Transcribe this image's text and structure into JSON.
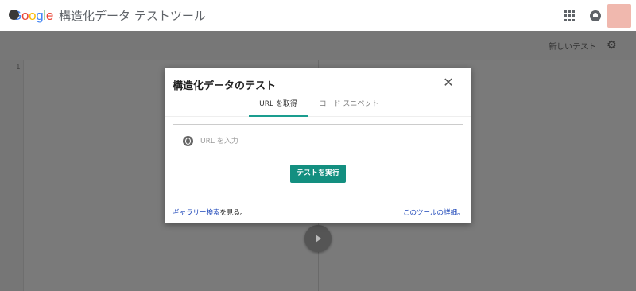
{
  "app": {
    "logo_letters": [
      {
        "ch": "G",
        "color": "#4285F4"
      },
      {
        "ch": "o",
        "color": "#EA4335"
      },
      {
        "ch": "o",
        "color": "#FBBC05"
      },
      {
        "ch": "g",
        "color": "#4285F4"
      },
      {
        "ch": "l",
        "color": "#34A853"
      },
      {
        "ch": "e",
        "color": "#EA4335"
      }
    ],
    "title": "構造化データ テストツール",
    "apps_icon": "apps-grid-icon",
    "notifications_icon": "bell-icon"
  },
  "toolbar": {
    "new_test_label": "新しいテスト",
    "settings_icon": "gear-icon",
    "url_icon": "globe-icon"
  },
  "editor": {
    "line_number": "1"
  },
  "dialog": {
    "title": "構造化データのテスト",
    "tabs": [
      {
        "label": "URL を取得",
        "active": true
      },
      {
        "label": "コード スニペット",
        "active": false
      }
    ],
    "url_placeholder": "URL を入力",
    "run_button": "テストを実行",
    "gallery_prefix": "ギャラリー検索",
    "gallery_suffix": "を見る。",
    "details_link": "このツールの詳細。"
  },
  "colors": {
    "accent": "#138f80",
    "link": "#1a44b8"
  }
}
